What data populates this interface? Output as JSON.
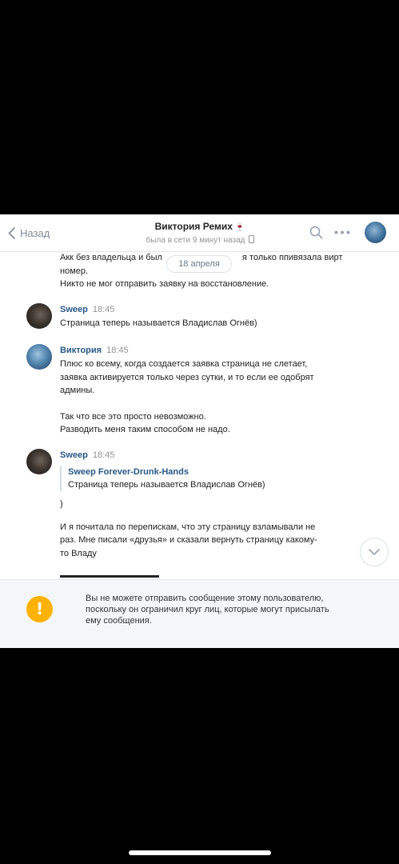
{
  "header": {
    "back_label": "Назад",
    "title": "Виктория Ремих",
    "title_emoji": "🍷",
    "status": "была в сети 9 минут назад"
  },
  "date_divider": "18 апреля",
  "messages": [
    {
      "lines": [
        "Акк без владельца и был",
        "я только ппивязала вирт",
        "номер.",
        "Никто не мог отправить заявку на восстановление."
      ]
    },
    {
      "author": "Sweep",
      "time": "18:45",
      "lines": [
        "Страница теперь называется Владислав Огнёв)"
      ]
    },
    {
      "author": "Виктория",
      "time": "18:45",
      "lines": [
        "Плюс ко всему, когда создается заявка страница не слетает,",
        "заявка активируется только через сутки, и то если ее одобрят",
        "админы.",
        "Так что все это просто невозможно.",
        "Разводить меня таким способом не надо."
      ]
    },
    {
      "author": "Sweep",
      "time": "18:45",
      "forward": {
        "author": "Sweep Forever-Drunk-Hands",
        "text": "Страница теперь называется Владислав Огнёв)"
      },
      "lines": [
        ")",
        "И я почитала по перепискам, что эту страницу взламывали не",
        "раз. Мне писали «друзья» и сказали вернуть страницу какому-",
        "то Владу"
      ]
    }
  ],
  "footer": {
    "warning_lines": [
      "Вы не можете отправить сообщение этому пользователю,",
      "поскольку он ограничил круг лиц, которые могут присылать",
      "ему сообщения."
    ]
  },
  "colors": {
    "link": "#2a5885",
    "warning": "#ffb300",
    "background": "#000000"
  }
}
